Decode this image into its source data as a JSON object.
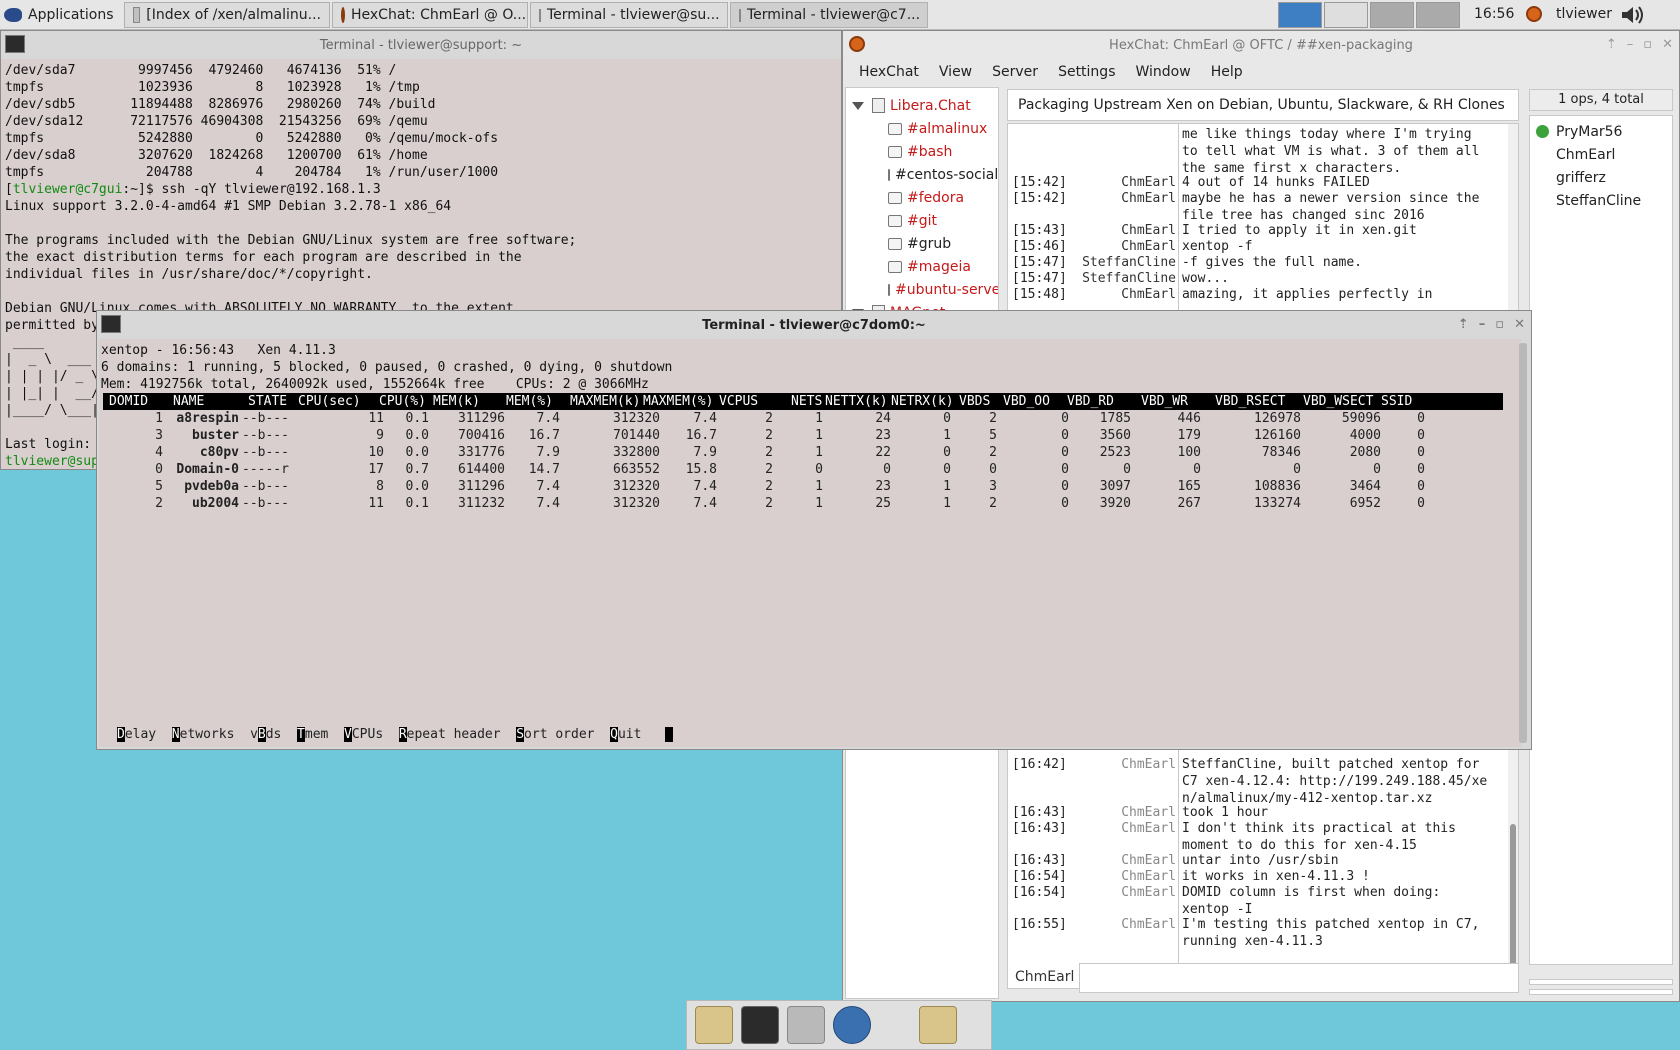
{
  "panel": {
    "apps_label": "Applications",
    "tasks": [
      {
        "label": "[Index of /xen/almalinu..."
      },
      {
        "label": "HexChat: ChmEarl @ O..."
      },
      {
        "label": "Terminal - tlviewer@su..."
      },
      {
        "label": "Terminal - tlviewer@c7..."
      }
    ],
    "clock": "16:56",
    "user": "tlviewer"
  },
  "term1": {
    "title": "Terminal - tlviewer@support: ~",
    "lines": [
      "/dev/sda7        9997456  4792460   4674136  51% /",
      "tmpfs            1023936        8   1023928   1% /tmp",
      "/dev/sdb5       11894488  8286976   2980260  74% /build",
      "/dev/sda12      72117576 46904308  21543256  69% /qemu",
      "tmpfs            5242880        0   5242880   0% /qemu/mock-ofs",
      "/dev/sda8        3207620  1824268   1200700  61% /home",
      "tmpfs             204788        4    204784   1% /run/user/1000",
      "",
      "Linux support 3.2.0-4-amd64 #1 SMP Debian 3.2.78-1 x86_64",
      "",
      "The programs included with the Debian GNU/Linux system are free software;",
      "the exact distribution terms for each program are described in the",
      "individual files in /usr/share/doc/*/copyright.",
      "",
      "Debian GNU/Linux comes with ABSOLUTELY NO WARRANTY, to the extent",
      "permitted by",
      " ____",
      "|  _ \\  ___",
      "| | | |/ _ \\",
      "| |_| |  __/",
      "|____/ \\___|",
      "",
      "Last login:",
      ""
    ],
    "prompt_user": "tlviewer@c7gui",
    "prompt_cmd": ":~]$ ssh -qY tlviewer@192.168.1.3",
    "prompt2": "tlviewer@sup"
  },
  "hexchat": {
    "title": "HexChat: ChmEarl @ OFTC / ##xen-packaging",
    "menu": [
      "HexChat",
      "View",
      "Server",
      "Settings",
      "Window",
      "Help"
    ],
    "servers": [
      {
        "name": "Libera.Chat",
        "channels": [
          {
            "name": "#almalinux",
            "red": true
          },
          {
            "name": "#bash",
            "red": true
          },
          {
            "name": "#centos-social",
            "red": false
          },
          {
            "name": "#fedora",
            "red": true
          },
          {
            "name": "#git",
            "red": true
          },
          {
            "name": "#grub",
            "red": false
          },
          {
            "name": "#mageia",
            "red": true
          },
          {
            "name": "#ubuntu-server",
            "red": true
          }
        ]
      },
      {
        "name": "MAGnet",
        "channels": []
      }
    ],
    "topic": "Packaging Upstream Xen on Debian, Ubuntu, Slackware, & RH Clones",
    "ops_summary": "1 ops, 4 total",
    "users": [
      "PryMar56",
      "ChmEarl",
      "grifferz",
      "SteffanCline"
    ],
    "nick": "ChmEarl",
    "chat_top": [
      {
        "time": "",
        "nick": "",
        "text": "me like things today where I'm trying\nto tell what VM is what. 3 of them all\nthe same first x characters."
      },
      {
        "time": "[15:42]",
        "nick": "ChmEarl",
        "text": "4 out of 14 hunks FAILED"
      },
      {
        "time": "[15:42]",
        "nick": "ChmEarl",
        "text": "maybe he has a newer version since the\nfile tree has changed sinc 2016"
      },
      {
        "time": "[15:43]",
        "nick": "ChmEarl",
        "text": "I tried to apply it in xen.git"
      },
      {
        "time": "[15:46]",
        "nick": "ChmEarl",
        "text": "xentop -f"
      },
      {
        "time": "[15:47]",
        "nick": "SteffanCline",
        "text": "-f gives the full name."
      },
      {
        "time": "[15:47]",
        "nick": "SteffanCline",
        "text": "wow..."
      },
      {
        "time": "[15:48]",
        "nick": "ChmEarl",
        "text": "amazing, it applies perfectly in"
      }
    ],
    "chat_bottom": [
      {
        "time": "[16:42]",
        "nick": "ChmEarl",
        "text": "SteffanCline, built patched xentop for\nC7 xen-4.12.4: http://199.249.188.45/xe\nn/almalinux/my-412-xentop.tar.xz"
      },
      {
        "time": "[16:43]",
        "nick": "ChmEarl",
        "text": "took 1 hour"
      },
      {
        "time": "[16:43]",
        "nick": "ChmEarl",
        "text": "I don't think its practical at this\nmoment to do this for xen-4.15"
      },
      {
        "time": "[16:43]",
        "nick": "ChmEarl",
        "text": "untar into /usr/sbin"
      },
      {
        "time": "[16:54]",
        "nick": "ChmEarl",
        "text": "it works in xen-4.11.3 !"
      },
      {
        "time": "[16:54]",
        "nick": "ChmEarl",
        "text": "DOMID column is first when doing:\nxentop -I"
      },
      {
        "time": "[16:55]",
        "nick": "ChmEarl",
        "text": "I'm testing this patched xentop in C7,\nrunning xen-4.11.3"
      }
    ]
  },
  "term2": {
    "title": "Terminal - tlviewer@c7dom0:~",
    "summary": [
      "xentop - 16:56:43   Xen 4.11.3",
      "6 domains: 1 running, 5 blocked, 0 paused, 0 crashed, 0 dying, 0 shutdown",
      "Mem: 4192756k total, 2640092k used, 1552664k free    CPUs: 2 @ 3066MHz"
    ],
    "columns": [
      "DOMID",
      "NAME",
      "STATE",
      "CPU(sec)",
      "CPU(%)",
      "MEM(k)",
      "MEM(%)",
      "MAXMEM(k)",
      "MAXMEM(%)",
      "VCPUS",
      "NETS",
      "NETTX(k)",
      "NETRX(k)",
      "VBDS",
      "VBD_OO",
      "VBD_RD",
      "VBD_WR",
      "VBD_RSECT",
      "VBD_WSECT",
      "SSID"
    ],
    "rows": [
      [
        "1",
        "a8respin",
        "--b---",
        "11",
        "0.1",
        "311296",
        "7.4",
        "312320",
        "7.4",
        "2",
        "1",
        "24",
        "0",
        "2",
        "0",
        "1785",
        "446",
        "126978",
        "59096",
        "0"
      ],
      [
        "3",
        "buster",
        "--b---",
        "9",
        "0.0",
        "700416",
        "16.7",
        "701440",
        "16.7",
        "2",
        "1",
        "23",
        "1",
        "5",
        "0",
        "3560",
        "179",
        "126160",
        "4000",
        "0"
      ],
      [
        "4",
        "c80pv",
        "--b---",
        "10",
        "0.0",
        "331776",
        "7.9",
        "332800",
        "7.9",
        "2",
        "1",
        "22",
        "0",
        "2",
        "0",
        "2523",
        "100",
        "78346",
        "2080",
        "0"
      ],
      [
        "0",
        "Domain-0",
        "-----r",
        "17",
        "0.7",
        "614400",
        "14.7",
        "663552",
        "15.8",
        "2",
        "0",
        "0",
        "0",
        "0",
        "0",
        "0",
        "0",
        "0",
        "0",
        "0"
      ],
      [
        "5",
        "pvdeb0a",
        "--b---",
        "8",
        "0.0",
        "311296",
        "7.4",
        "312320",
        "7.4",
        "2",
        "1",
        "23",
        "1",
        "3",
        "0",
        "3097",
        "165",
        "108836",
        "3464",
        "0"
      ],
      [
        "2",
        "ub2004",
        "--b---",
        "11",
        "0.1",
        "311232",
        "7.4",
        "312320",
        "7.4",
        "2",
        "1",
        "25",
        "1",
        "2",
        "0",
        "3920",
        "267",
        "133274",
        "6952",
        "0"
      ]
    ],
    "menu": [
      {
        "key": "D",
        "rest": "elay"
      },
      {
        "key": "N",
        "rest": "etworks"
      },
      {
        "key": "v",
        "key2": "B",
        "rest": "ds"
      },
      {
        "key": "T",
        "rest": "mem"
      },
      {
        "key": "V",
        "rest": "CPUs"
      },
      {
        "key": "R",
        "rest": "epeat header"
      },
      {
        "key": "S",
        "rest": "ort order"
      },
      {
        "key": "Q",
        "rest": "uit"
      }
    ]
  }
}
